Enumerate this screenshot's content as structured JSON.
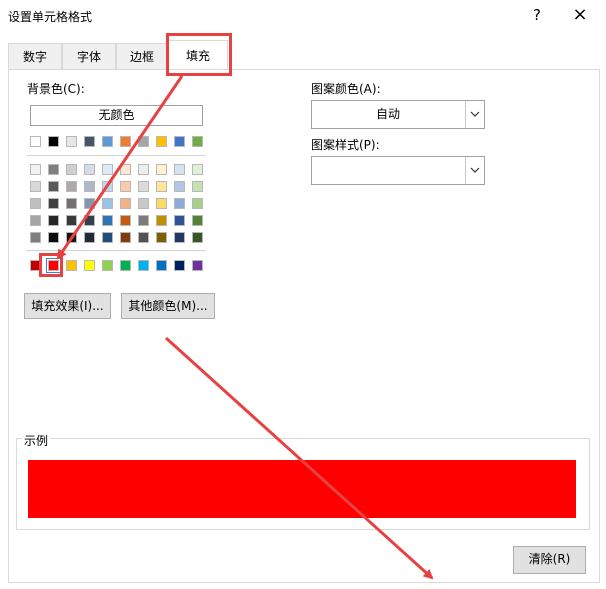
{
  "window": {
    "title": "设置单元格格式",
    "help": "?",
    "close": "×"
  },
  "tabs": [
    {
      "label": "数字"
    },
    {
      "label": "字体"
    },
    {
      "label": "边框"
    },
    {
      "label": "填充"
    }
  ],
  "active_tab": "填充",
  "background": {
    "label": "背景色(C):",
    "no_color_button": "无颜色",
    "selected_color": "#ff0000"
  },
  "palette": {
    "row1": [
      "#ffffff",
      "#000000",
      "#e7e6e6",
      "#44546a",
      "#5b9bd5",
      "#ed7d31",
      "#a5a5a5",
      "#ffc000",
      "#4472c4",
      "#70ad47"
    ],
    "tint_rows": [
      [
        "#f2f2f2",
        "#7f7f7f",
        "#d0cece",
        "#d6dce4",
        "#deebf6",
        "#fbe5d5",
        "#ededed",
        "#fff2cc",
        "#d9e2f3",
        "#e2efd9"
      ],
      [
        "#d8d8d8",
        "#595959",
        "#aeaaaa",
        "#adb9ca",
        "#bdd7ee",
        "#f7cbac",
        "#dbdbdb",
        "#fee599",
        "#b4c6e7",
        "#c5e0b3"
      ],
      [
        "#bfbfbf",
        "#3f3f3f",
        "#757070",
        "#8496b0",
        "#9cc3e5",
        "#f4b183",
        "#c9c9c9",
        "#ffd966",
        "#8eaadb",
        "#a8d08d"
      ],
      [
        "#a5a5a5",
        "#262626",
        "#3a3838",
        "#323f4f",
        "#2e75b5",
        "#c55a11",
        "#7b7b7b",
        "#bf9000",
        "#2f5496",
        "#538135"
      ],
      [
        "#7f7f7f",
        "#0c0c0c",
        "#171616",
        "#222a35",
        "#1e4e79",
        "#843c0b",
        "#525252",
        "#7f6000",
        "#1f3864",
        "#375623"
      ]
    ],
    "standard": [
      "#c00000",
      "#ff0000",
      "#ffc000",
      "#ffff00",
      "#92d050",
      "#00b050",
      "#00b0f0",
      "#0070c0",
      "#002060",
      "#7030a0"
    ]
  },
  "buttons": {
    "fill_effects": "填充效果(I)...",
    "more_colors": "其他颜色(M)...",
    "clear": "清除(R)"
  },
  "pattern": {
    "color_label": "图案颜色(A):",
    "color_value": "自动",
    "style_label": "图案样式(P):",
    "style_value": ""
  },
  "sample": {
    "label": "示例",
    "color": "#ff0000"
  },
  "colors": {
    "annotation_red": "#e84142"
  }
}
